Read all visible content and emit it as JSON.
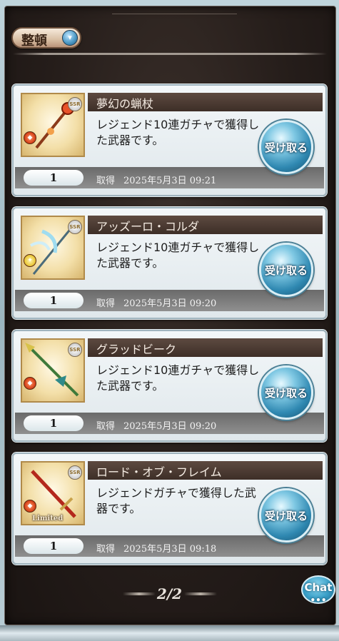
{
  "toolbar": {
    "sort_label": "整頓",
    "sort_icon": "chevron-down-icon"
  },
  "items": [
    {
      "title": "夢幻の蝋杖",
      "description": "レジェンド10連ガチャで獲得した武器です。",
      "count": "1",
      "acquired_label": "取得",
      "acquired_date": "2025年5月3日 09:21",
      "rarity": "SSR",
      "element": "fire",
      "limited": "",
      "receive_label": "受け取る"
    },
    {
      "title": "アッズーロ・コルダ",
      "description": "レジェンド10連ガチャで獲得した武器です。",
      "count": "1",
      "acquired_label": "取得",
      "acquired_date": "2025年5月3日 09:20",
      "rarity": "SSR",
      "element": "light",
      "limited": "",
      "receive_label": "受け取る"
    },
    {
      "title": "グラッドビーク",
      "description": "レジェンド10連ガチャで獲得した武器です。",
      "count": "1",
      "acquired_label": "取得",
      "acquired_date": "2025年5月3日 09:20",
      "rarity": "SSR",
      "element": "fire",
      "limited": "",
      "receive_label": "受け取る"
    },
    {
      "title": "ロード・オブ・フレイム",
      "description": "レジェンドガチャで獲得した武器です。",
      "count": "1",
      "acquired_label": "取得",
      "acquired_date": "2025年5月3日 09:18",
      "rarity": "SSR",
      "element": "fire",
      "limited": "Limited",
      "receive_label": "受け取る"
    }
  ],
  "pager": {
    "page_text": "2/2"
  },
  "chat": {
    "label": "Chat",
    "dots": "•••"
  },
  "colors": {
    "panel": "#251d1a",
    "title_bar": "#4a3a31",
    "receive_button": "#2f88b1"
  }
}
